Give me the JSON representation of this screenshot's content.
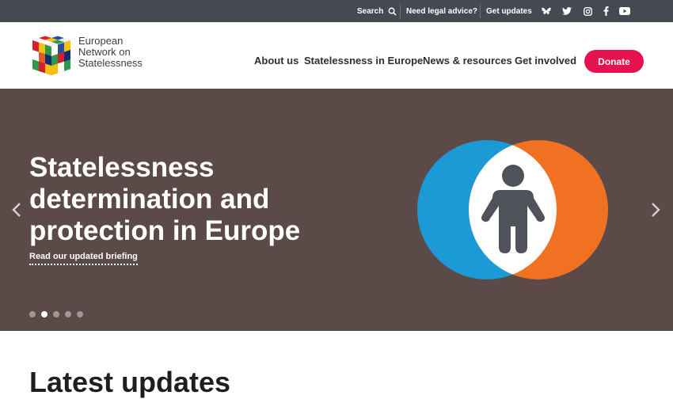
{
  "topbar": {
    "search_label": "Search",
    "search_icon": "search-icon",
    "legal_label": "Need legal advice?",
    "updates_label": "Get updates",
    "social": [
      "bluesky-icon",
      "twitter-icon",
      "instagram-icon",
      "facebook-icon",
      "youtube-icon"
    ]
  },
  "header": {
    "logo_line1": "European",
    "logo_line2": "Network on",
    "logo_line3": "Statelessness",
    "nav": [
      "About us",
      "Statelessness in Europe",
      "News & resources",
      "Get involved"
    ],
    "donate_label": "Donate"
  },
  "hero": {
    "title_line1": "Statelessness",
    "title_line2": "determination and",
    "title_line3": "protection in Europe",
    "link_label": "Read our updated briefing",
    "slide_count": 5,
    "active_slide": 2
  },
  "section": {
    "heading": "Latest updates"
  },
  "colors": {
    "topbar": "#454a52",
    "hero_bg": "#5c4a49",
    "donate": "#e6124f",
    "circle_blue": "#1b9ad6",
    "circle_orange": "#f07122",
    "figure": "#4f5259"
  }
}
